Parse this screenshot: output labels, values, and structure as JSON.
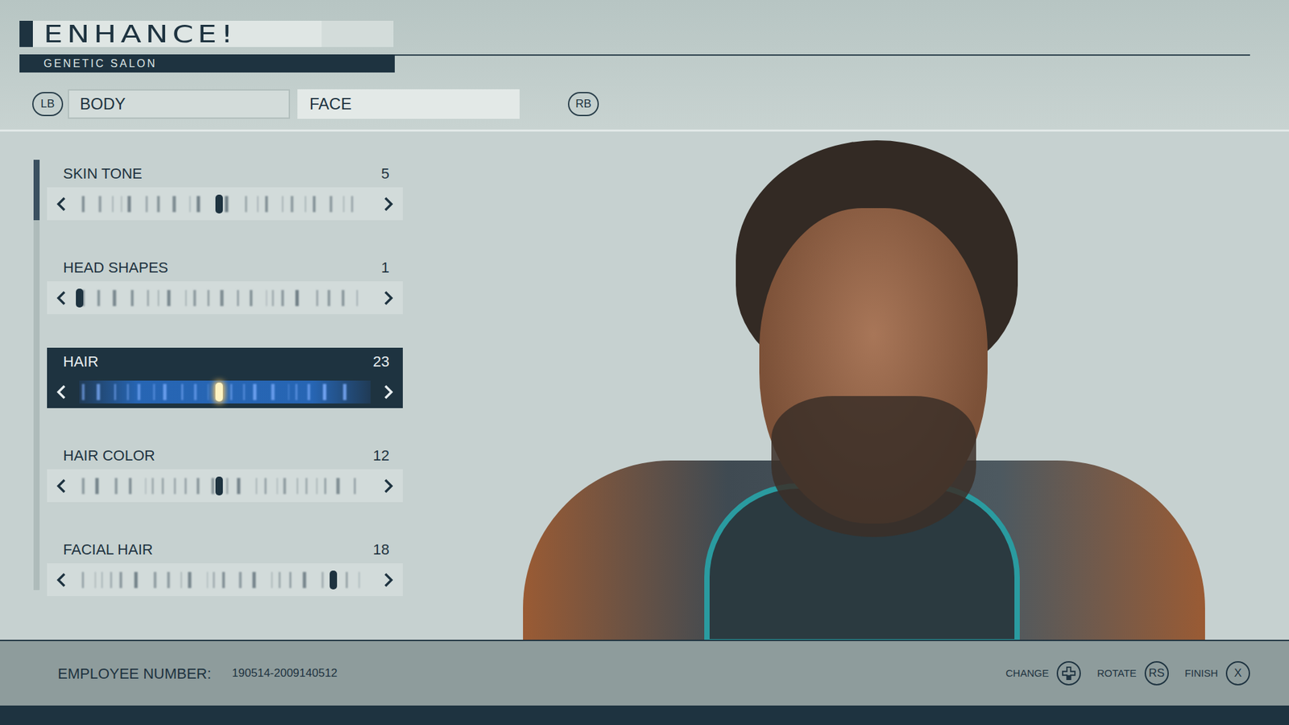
{
  "header": {
    "logo": "ENHANCE!",
    "subtitle": "GENETIC SALON"
  },
  "tabs": {
    "prev_key": "LB",
    "next_key": "RB",
    "items": [
      {
        "label": "BODY",
        "selected": false
      },
      {
        "label": "FACE",
        "selected": true
      }
    ]
  },
  "scrollbar": {
    "level": 0.14
  },
  "sliders": [
    {
      "label": "SKIN TONE",
      "value": "5",
      "level": 0.48,
      "selected": false
    },
    {
      "label": "HEAD SHAPES",
      "value": "1",
      "level": 0.0,
      "selected": false
    },
    {
      "label": "HAIR",
      "value": "23",
      "level": 0.48,
      "selected": true
    },
    {
      "label": "HAIR COLOR",
      "value": "12",
      "level": 0.48,
      "selected": false
    },
    {
      "label": "FACIAL HAIR",
      "value": "18",
      "level": 0.87,
      "selected": false
    }
  ],
  "footer": {
    "employee_label": "EMPLOYEE NUMBER:",
    "employee_number": "190514-2009140512",
    "hints": [
      {
        "label": "CHANGE",
        "kind": "dpad"
      },
      {
        "label": "ROTATE",
        "kind": "button",
        "key": "RS"
      },
      {
        "label": "FINISH",
        "kind": "button",
        "key": "X"
      }
    ]
  }
}
